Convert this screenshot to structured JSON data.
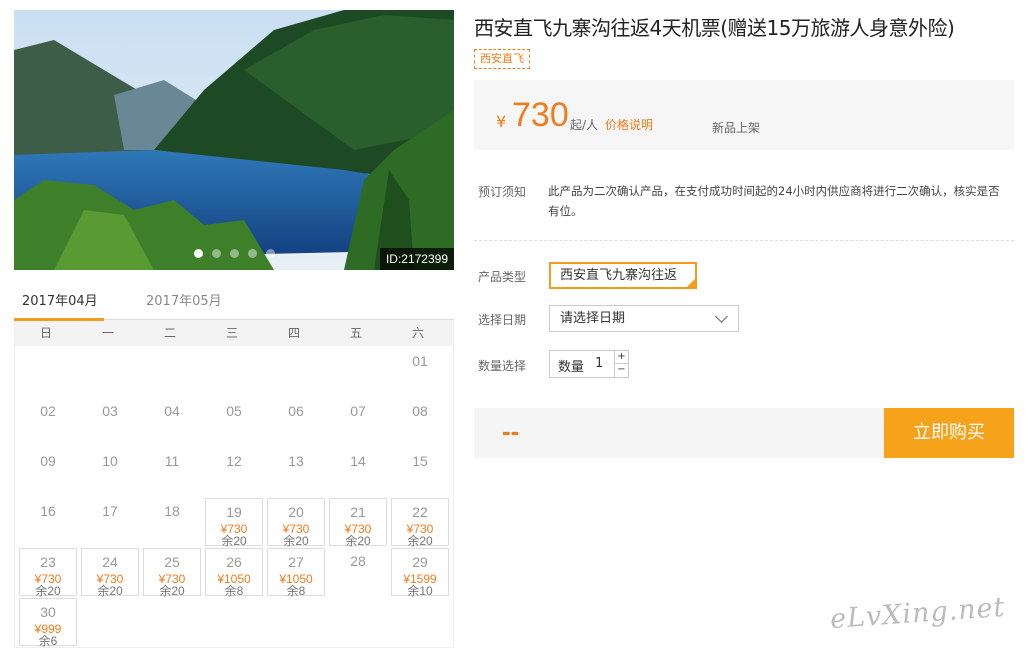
{
  "gallery": {
    "id_text": "ID:2172399",
    "slide_count": 5,
    "active_slide": 0
  },
  "product": {
    "title": "西安直飞九寨沟往返4天机票(赠送15万旅游人身意外险)",
    "tag": "西安直飞"
  },
  "price": {
    "currency": "¥",
    "amount": "730",
    "unit": "起/人",
    "note": "价格说明",
    "status": "新品上架"
  },
  "notice": {
    "label": "预订须知",
    "text": "此产品为二次确认产品，在支付成功时间起的24小时内供应商将进行二次确认，核实是否有位。"
  },
  "form": {
    "type_label": "产品类型",
    "type_value": "西安直飞九寨沟往返",
    "date_label": "选择日期",
    "date_placeholder": "请选择日期",
    "qty_label": "数量选择",
    "qty_inner_label": "数量",
    "qty_value": "1",
    "plus": "+",
    "minus": "−"
  },
  "buy": {
    "total": "--",
    "button": "立即购买"
  },
  "calendar": {
    "tabs": [
      "2017年04月",
      "2017年05月"
    ],
    "active_tab": 0,
    "weekdays": [
      "日",
      "一",
      "二",
      "三",
      "四",
      "五",
      "六"
    ],
    "days": [
      {
        "d": "01",
        "col": 6,
        "row": 0
      },
      {
        "d": "02",
        "col": 0,
        "row": 1
      },
      {
        "d": "03",
        "col": 1,
        "row": 1
      },
      {
        "d": "04",
        "col": 2,
        "row": 1
      },
      {
        "d": "05",
        "col": 3,
        "row": 1
      },
      {
        "d": "06",
        "col": 4,
        "row": 1
      },
      {
        "d": "07",
        "col": 5,
        "row": 1
      },
      {
        "d": "08",
        "col": 6,
        "row": 1
      },
      {
        "d": "09",
        "col": 0,
        "row": 2
      },
      {
        "d": "10",
        "col": 1,
        "row": 2
      },
      {
        "d": "11",
        "col": 2,
        "row": 2
      },
      {
        "d": "12",
        "col": 3,
        "row": 2
      },
      {
        "d": "13",
        "col": 4,
        "row": 2
      },
      {
        "d": "14",
        "col": 5,
        "row": 2
      },
      {
        "d": "15",
        "col": 6,
        "row": 2
      },
      {
        "d": "16",
        "col": 0,
        "row": 3
      },
      {
        "d": "17",
        "col": 1,
        "row": 3
      },
      {
        "d": "18",
        "col": 2,
        "row": 3
      },
      {
        "d": "19",
        "col": 3,
        "row": 3,
        "price": "¥730",
        "left": "余20"
      },
      {
        "d": "20",
        "col": 4,
        "row": 3,
        "price": "¥730",
        "left": "余20"
      },
      {
        "d": "21",
        "col": 5,
        "row": 3,
        "price": "¥730",
        "left": "余20"
      },
      {
        "d": "22",
        "col": 6,
        "row": 3,
        "price": "¥730",
        "left": "余20"
      },
      {
        "d": "23",
        "col": 0,
        "row": 4,
        "price": "¥730",
        "left": "余20"
      },
      {
        "d": "24",
        "col": 1,
        "row": 4,
        "price": "¥730",
        "left": "余20"
      },
      {
        "d": "25",
        "col": 2,
        "row": 4,
        "price": "¥730",
        "left": "余20"
      },
      {
        "d": "26",
        "col": 3,
        "row": 4,
        "price": "¥1050",
        "left": "余8"
      },
      {
        "d": "27",
        "col": 4,
        "row": 4,
        "price": "¥1050",
        "left": "余8"
      },
      {
        "d": "28",
        "col": 5,
        "row": 4
      },
      {
        "d": "29",
        "col": 6,
        "row": 4,
        "price": "¥1599",
        "left": "余10"
      },
      {
        "d": "30",
        "col": 0,
        "row": 5,
        "price": "¥999",
        "left": "余6"
      }
    ]
  },
  "watermark": "eLvXing.net",
  "colors": {
    "accent": "#f07c1d",
    "buy": "#f7a21b"
  }
}
